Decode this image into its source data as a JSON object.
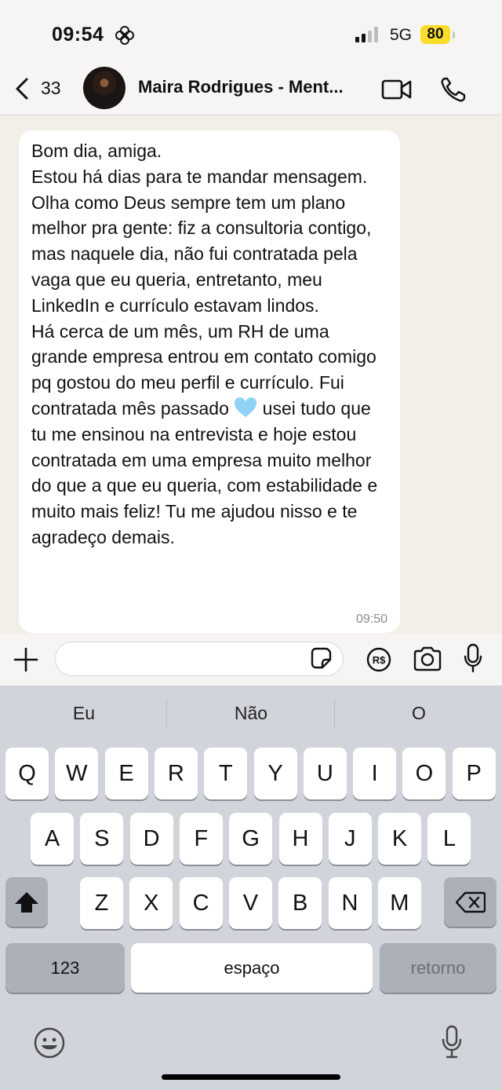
{
  "status_bar": {
    "time": "09:54",
    "network": "5G",
    "battery": "80"
  },
  "header": {
    "back_count": "33",
    "contact_name": "Maira Rodrigues - Ment..."
  },
  "message": {
    "text": "Bom dia, amiga.\nEstou há dias para te mandar mensagem.\nOlha como Deus sempre tem um plano melhor pra gente: fiz a consultoria contigo, mas naquele dia, não fui contratada pela vaga que eu queria, entretanto, meu LinkedIn e currículo estavam lindos.\nHá cerca de um mês, um RH de uma grande empresa entrou em contato comigo pq gostou do meu perfil e currículo. Fui contratada mês passado ",
    "text_after_emoji": " usei tudo que tu me ensinou na entrevista e hoje estou contratada em uma empresa muito melhor do que a que eu queria, com estabilidade e muito mais feliz! Tu me ajudou nisso e te agradeço demais.",
    "emoji": "light-blue-heart-icon",
    "time": "09:50"
  },
  "input_bar": {
    "placeholder": ""
  },
  "keyboard": {
    "suggestions": [
      "Eu",
      "Não",
      "O"
    ],
    "row1": [
      "Q",
      "W",
      "E",
      "R",
      "T",
      "Y",
      "U",
      "I",
      "O",
      "P"
    ],
    "row2": [
      "A",
      "S",
      "D",
      "F",
      "G",
      "H",
      "J",
      "K",
      "L"
    ],
    "row3": [
      "Z",
      "X",
      "C",
      "V",
      "B",
      "N",
      "M"
    ],
    "numbers_label": "123",
    "space_label": "espaço",
    "return_label": "retorno"
  },
  "colors": {
    "battery": "#f8dd2b",
    "heart": "#8fd3f5",
    "keyboard_bg": "#d1d4da"
  }
}
